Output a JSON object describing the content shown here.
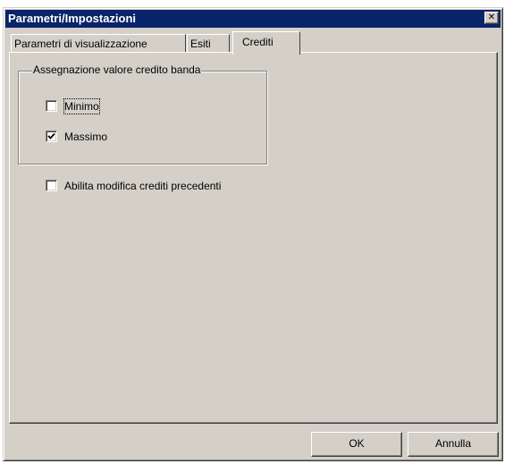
{
  "window": {
    "title": "Parametri/Impostazioni",
    "close_glyph": "✕"
  },
  "tabs": [
    {
      "label": "Parametri di visualizzazione",
      "active": false
    },
    {
      "label": "Esiti",
      "active": false
    },
    {
      "label": "Crediti",
      "active": true
    }
  ],
  "group": {
    "label": "Assegnazione valore credito banda",
    "options": [
      {
        "label": "Minimo",
        "checked": false
      },
      {
        "label": "Massimo",
        "checked": true
      }
    ]
  },
  "enable_edit": {
    "label": "Abilita modifica crediti precedenti",
    "checked": false
  },
  "buttons": {
    "ok": "OK",
    "cancel": "Annulla"
  },
  "colors": {
    "titlebar": "#0a246a",
    "face": "#d4d0c8"
  },
  "icons": {
    "close": "close-icon",
    "check": "checkmark-icon"
  }
}
